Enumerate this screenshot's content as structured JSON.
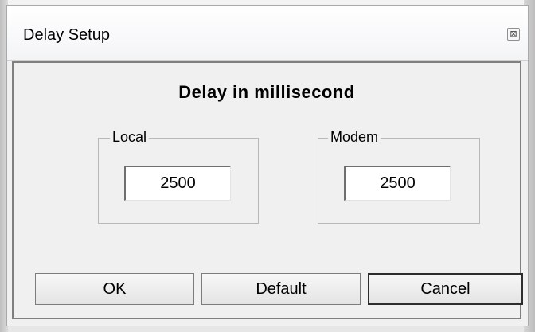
{
  "window": {
    "title": "Delay Setup",
    "close_glyph": "⊠"
  },
  "heading": "Delay in millisecond",
  "groups": {
    "local": {
      "label": "Local",
      "value": "2500"
    },
    "modem": {
      "label": "Modem",
      "value": "2500"
    }
  },
  "buttons": {
    "ok": "OK",
    "default": "Default",
    "cancel": "Cancel"
  }
}
